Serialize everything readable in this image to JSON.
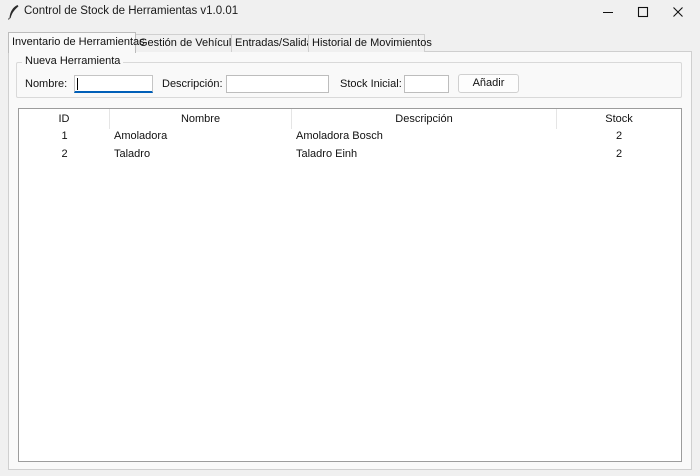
{
  "window": {
    "title": "Control de Stock de Herramientas v1.0.01"
  },
  "tabs": [
    {
      "label": "Inventario de Herramientas",
      "active": true
    },
    {
      "label": "Gestión de Vehículos",
      "active": false
    },
    {
      "label": "Entradas/Salidas",
      "active": false
    },
    {
      "label": "Historial de Movimientos",
      "active": false
    }
  ],
  "form": {
    "group_title": "Nueva Herramienta",
    "nombre_label": "Nombre:",
    "nombre_value": "",
    "descripcion_label": "Descripción:",
    "descripcion_value": "",
    "stock_label": "Stock Inicial:",
    "stock_value": "",
    "add_button": "Añadir"
  },
  "table": {
    "columns": [
      "ID",
      "Nombre",
      "Descripción",
      "Stock"
    ],
    "rows": [
      {
        "id": "1",
        "nombre": "Amoladora",
        "descripcion": "Amoladora Bosch",
        "stock": "2"
      },
      {
        "id": "2",
        "nombre": "Taladro",
        "descripcion": "Taladro Einh",
        "stock": "2"
      }
    ]
  },
  "colors": {
    "accent": "#005fb8",
    "window_bg": "#f0f0f0",
    "panel_bg": "#f9f9f9"
  }
}
